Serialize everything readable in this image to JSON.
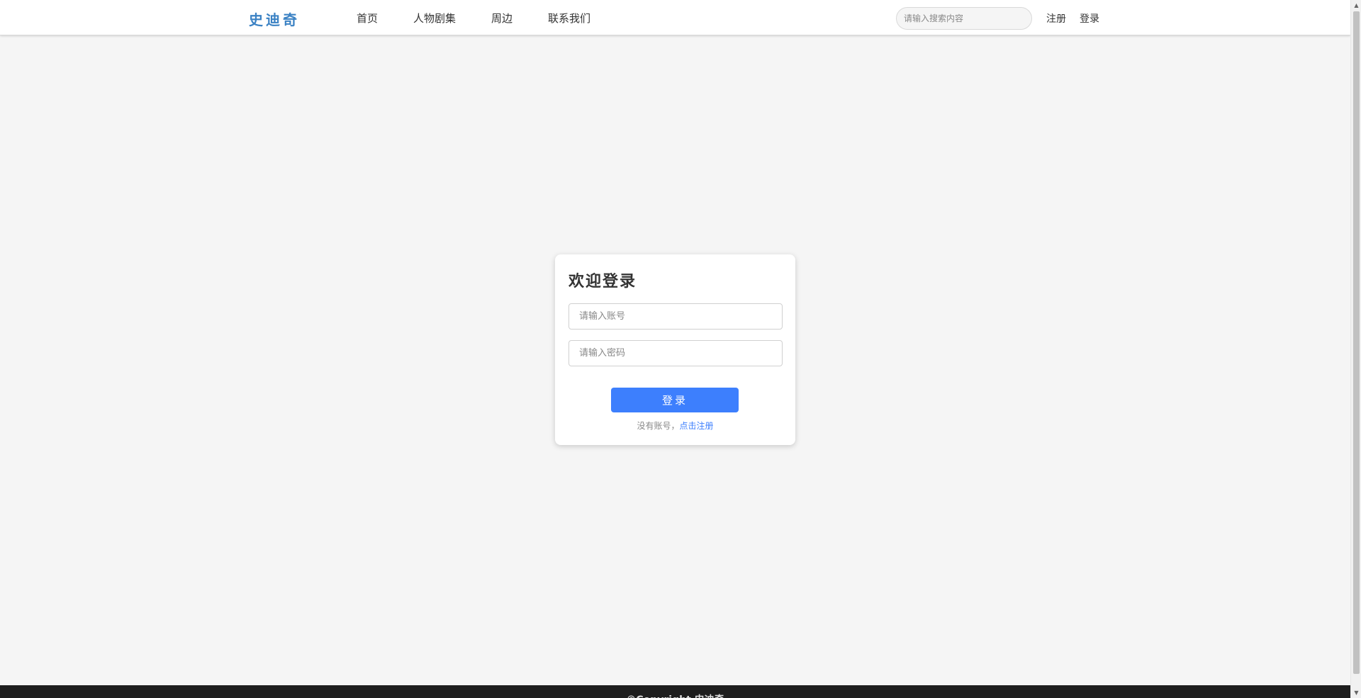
{
  "header": {
    "logo": "史迪奇",
    "nav": [
      "首页",
      "人物剧集",
      "周边",
      "联系我们"
    ],
    "search_placeholder": "请输入搜索内容",
    "register": "注册",
    "login": "登录"
  },
  "login_card": {
    "title": "欢迎登录",
    "account_placeholder": "请输入账号",
    "password_placeholder": "请输入密码",
    "submit": "登录",
    "no_account": "没有账号，",
    "register_link": "点击注册"
  },
  "footer": {
    "text": "©Copyright 史迪奇"
  },
  "colors": {
    "logo": "#3b82c4",
    "primary": "#3d7ffd",
    "background": "#f5f5f5",
    "footer": "#1e1e1e"
  }
}
